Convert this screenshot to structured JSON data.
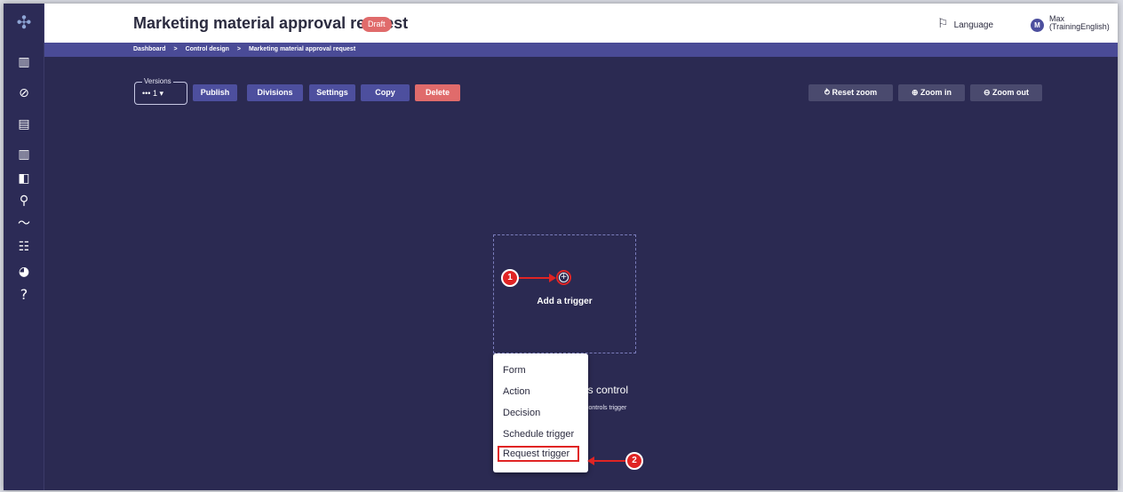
{
  "app": {
    "logo_icon": "windmill-logo-icon"
  },
  "sidebar": {
    "items": [
      {
        "icon": "dashboard-icon",
        "glyph": "▥"
      },
      {
        "icon": "check-circle-icon",
        "glyph": "⊘"
      },
      {
        "icon": "chat-icon",
        "glyph": "▤"
      },
      {
        "icon": "report-icon",
        "glyph": "▥"
      },
      {
        "icon": "library-icon",
        "glyph": "◧"
      },
      {
        "icon": "search-icon",
        "glyph": "⚲"
      },
      {
        "icon": "trend-icon",
        "glyph": "〜"
      },
      {
        "icon": "sliders-icon",
        "glyph": "☷"
      },
      {
        "icon": "shield-icon",
        "glyph": "◕"
      },
      {
        "icon": "help-icon",
        "glyph": "?"
      }
    ]
  },
  "header": {
    "title": "Marketing material approval request",
    "badge": "Draft",
    "language": "Language",
    "user_initial": "M",
    "user_name": "Max\n(TrainingEnglish)"
  },
  "breadcrumb": {
    "items": [
      "Dashboard",
      "Control design",
      "Marketing material approval request"
    ],
    "separator": ">"
  },
  "toolbar": {
    "versions_label": "Versions",
    "versions_value": "••• 1 ▾",
    "publish": "Publish",
    "divisions": "Divisions",
    "settings": "Settings",
    "copy": "Copy",
    "delete": "Delete",
    "reset_zoom": "⥁  Reset zoom",
    "zoom_in": "⊕  Zoom in",
    "zoom_out": "⊖  Zoom out"
  },
  "canvas": {
    "add_trigger_label": "Add a trigger",
    "add_symbol": "+",
    "partial_title": "is control",
    "partial_subtitle": "controls trigger"
  },
  "menu": {
    "items": [
      "Form",
      "Action",
      "Decision",
      "Schedule trigger",
      "Request trigger"
    ]
  },
  "callouts": {
    "one": "1",
    "two": "2"
  },
  "colors": {
    "accent": "#4d4f9e",
    "danger": "#e06b6b",
    "callout": "#e02424",
    "canvas_bg": "#2b2a52"
  }
}
